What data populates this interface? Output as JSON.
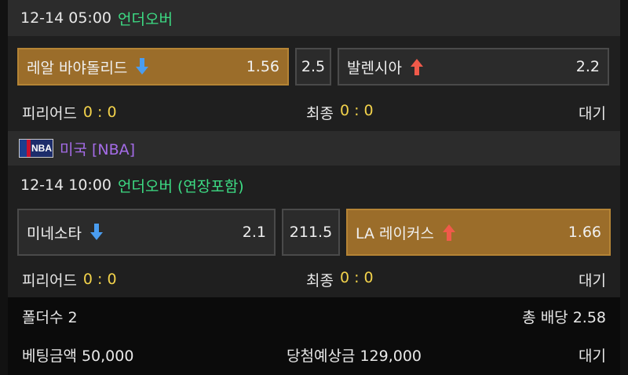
{
  "match1": {
    "time": "12-14 05:00",
    "type": "언더오버",
    "home": {
      "name": "레알 바야돌리드",
      "odds": "1.56",
      "arrow": "down"
    },
    "line": "2.5",
    "away": {
      "name": "발렌시아",
      "odds": "2.2",
      "arrow": "up"
    },
    "period_label": "피리어드",
    "period_score": "0 : 0",
    "final_label": "최종",
    "final_score": "0 : 0",
    "status": "대기"
  },
  "league": {
    "logo_text": "NBA",
    "name": "미국 [NBA]"
  },
  "match2": {
    "time": "12-14 10:00",
    "type": "언더오버 (연장포함)",
    "home": {
      "name": "미네소타",
      "odds": "2.1",
      "arrow": "down"
    },
    "line": "211.5",
    "away": {
      "name": "LA 레이커스",
      "odds": "1.66",
      "arrow": "up"
    },
    "period_label": "피리어드",
    "period_score": "0 : 0",
    "final_label": "최종",
    "final_score": "0 : 0",
    "status": "대기"
  },
  "summary": {
    "folder_count": "폴더수 2",
    "total_odds": "총 배당 2.58",
    "bet_amount": "베팅금액 50,000",
    "expected_win": "당첨예상금 129,000",
    "status": "대기"
  },
  "colors": {
    "selected": "#9b6d2a",
    "type_green": "#3ddc84",
    "score_yellow": "#f2d24b",
    "league_purple": "#a56ce8",
    "arrow_down": "#4a9df0",
    "arrow_up": "#f05a4a"
  }
}
